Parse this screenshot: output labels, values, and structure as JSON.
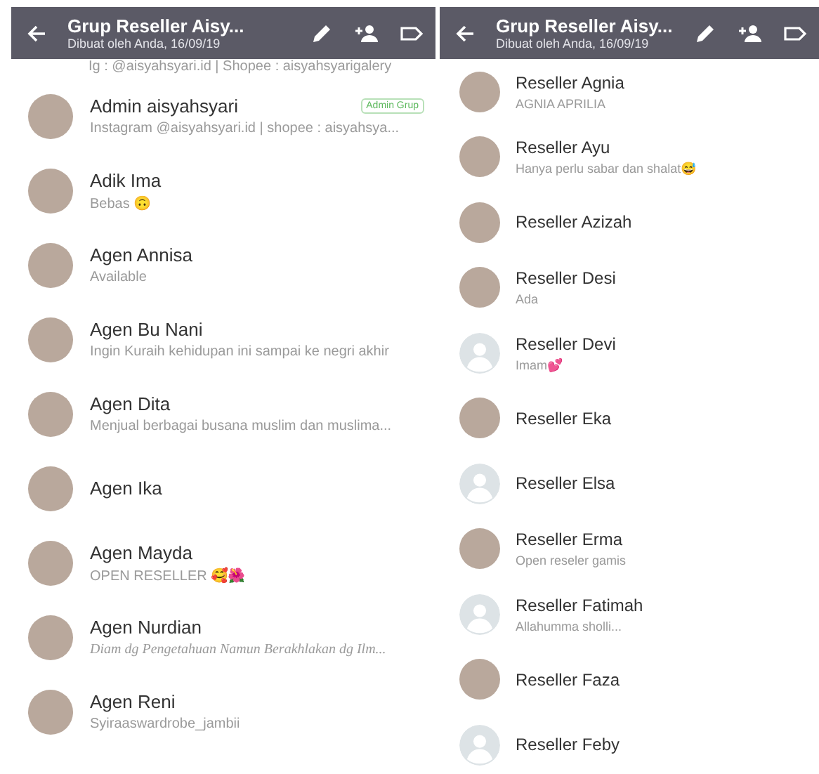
{
  "panels": [
    {
      "header": {
        "title": "Grup Reseller Aisy...",
        "subtitle": "Dibuat oleh Anda, 16/09/19"
      },
      "members": [
        {
          "kind": "cut",
          "status": "Ig : @aisyahsyari.id | Shopee : aisyahsyarigalery"
        },
        {
          "kind": "photo",
          "name": "Admin aisyahsyari",
          "status": "Instagram @aisyahsyari.id | shopee : aisyahsya...",
          "badge": "Admin Grup"
        },
        {
          "kind": "photo",
          "name": "Adik Ima",
          "status": "Bebas 🙃"
        },
        {
          "kind": "photo",
          "name": "Agen Annisa",
          "status": "Available"
        },
        {
          "kind": "photo",
          "name": "Agen Bu Nani",
          "status": "Ingin Kuraih kehidupan ini sampai ke negri akhir"
        },
        {
          "kind": "photo",
          "name": "Agen Dita",
          "status": "Menjual berbagai busana muslim dan muslima..."
        },
        {
          "kind": "photo",
          "name": "Agen Ika"
        },
        {
          "kind": "photo",
          "name": "Agen Mayda",
          "status": "OPEN RESELLER 🥰🌺"
        },
        {
          "kind": "photo",
          "name": "Agen Nurdian",
          "status": "Diam dg Pengetahuan Namun Berakhlakan dg Ilm...",
          "fancy": true
        },
        {
          "kind": "photo",
          "name": "Agen Reni",
          "status": "Syiraaswardrobe_jambii"
        }
      ]
    },
    {
      "header": {
        "title": "Grup Reseller Aisy...",
        "subtitle": "Dibuat oleh Anda, 16/09/19"
      },
      "members": [
        {
          "kind": "photo",
          "name": "Reseller Agnia",
          "status": "AGNIA APRILIA"
        },
        {
          "kind": "photo",
          "name": "Reseller Ayu",
          "status": "Hanya perlu sabar dan shalat😅"
        },
        {
          "kind": "photo",
          "name": "Reseller Azizah"
        },
        {
          "kind": "photo",
          "name": "Reseller Desi",
          "status": "Ada"
        },
        {
          "kind": "default",
          "name": "Reseller Devi",
          "status": "Imam💕"
        },
        {
          "kind": "photo",
          "name": "Reseller Eka"
        },
        {
          "kind": "default",
          "name": "Reseller Elsa"
        },
        {
          "kind": "photo",
          "name": "Reseller Erma",
          "status": "Open reseler gamis"
        },
        {
          "kind": "default",
          "name": "Reseller Fatimah",
          "status": "Allahumma sholli..."
        },
        {
          "kind": "photo",
          "name": "Reseller Faza"
        },
        {
          "kind": "default",
          "name": "Reseller Feby"
        }
      ]
    }
  ]
}
